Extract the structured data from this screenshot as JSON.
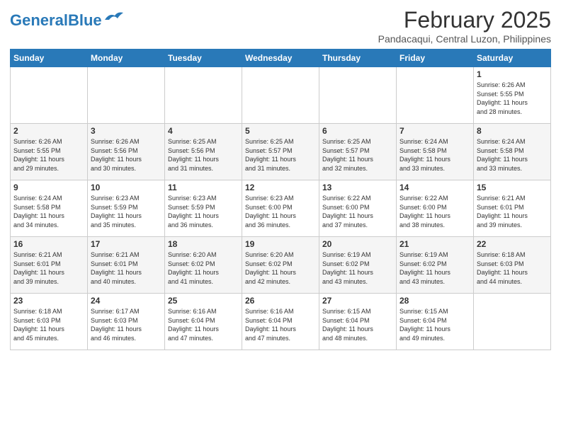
{
  "header": {
    "logo_general": "General",
    "logo_blue": "Blue",
    "month_title": "February 2025",
    "location": "Pandacaqui, Central Luzon, Philippines"
  },
  "weekdays": [
    "Sunday",
    "Monday",
    "Tuesday",
    "Wednesday",
    "Thursday",
    "Friday",
    "Saturday"
  ],
  "weeks": [
    [
      {
        "day": "",
        "info": ""
      },
      {
        "day": "",
        "info": ""
      },
      {
        "day": "",
        "info": ""
      },
      {
        "day": "",
        "info": ""
      },
      {
        "day": "",
        "info": ""
      },
      {
        "day": "",
        "info": ""
      },
      {
        "day": "1",
        "info": "Sunrise: 6:26 AM\nSunset: 5:55 PM\nDaylight: 11 hours\nand 28 minutes."
      }
    ],
    [
      {
        "day": "2",
        "info": "Sunrise: 6:26 AM\nSunset: 5:55 PM\nDaylight: 11 hours\nand 29 minutes."
      },
      {
        "day": "3",
        "info": "Sunrise: 6:26 AM\nSunset: 5:56 PM\nDaylight: 11 hours\nand 30 minutes."
      },
      {
        "day": "4",
        "info": "Sunrise: 6:25 AM\nSunset: 5:56 PM\nDaylight: 11 hours\nand 31 minutes."
      },
      {
        "day": "5",
        "info": "Sunrise: 6:25 AM\nSunset: 5:57 PM\nDaylight: 11 hours\nand 31 minutes."
      },
      {
        "day": "6",
        "info": "Sunrise: 6:25 AM\nSunset: 5:57 PM\nDaylight: 11 hours\nand 32 minutes."
      },
      {
        "day": "7",
        "info": "Sunrise: 6:24 AM\nSunset: 5:58 PM\nDaylight: 11 hours\nand 33 minutes."
      },
      {
        "day": "8",
        "info": "Sunrise: 6:24 AM\nSunset: 5:58 PM\nDaylight: 11 hours\nand 33 minutes."
      }
    ],
    [
      {
        "day": "9",
        "info": "Sunrise: 6:24 AM\nSunset: 5:58 PM\nDaylight: 11 hours\nand 34 minutes."
      },
      {
        "day": "10",
        "info": "Sunrise: 6:23 AM\nSunset: 5:59 PM\nDaylight: 11 hours\nand 35 minutes."
      },
      {
        "day": "11",
        "info": "Sunrise: 6:23 AM\nSunset: 5:59 PM\nDaylight: 11 hours\nand 36 minutes."
      },
      {
        "day": "12",
        "info": "Sunrise: 6:23 AM\nSunset: 6:00 PM\nDaylight: 11 hours\nand 36 minutes."
      },
      {
        "day": "13",
        "info": "Sunrise: 6:22 AM\nSunset: 6:00 PM\nDaylight: 11 hours\nand 37 minutes."
      },
      {
        "day": "14",
        "info": "Sunrise: 6:22 AM\nSunset: 6:00 PM\nDaylight: 11 hours\nand 38 minutes."
      },
      {
        "day": "15",
        "info": "Sunrise: 6:21 AM\nSunset: 6:01 PM\nDaylight: 11 hours\nand 39 minutes."
      }
    ],
    [
      {
        "day": "16",
        "info": "Sunrise: 6:21 AM\nSunset: 6:01 PM\nDaylight: 11 hours\nand 39 minutes."
      },
      {
        "day": "17",
        "info": "Sunrise: 6:21 AM\nSunset: 6:01 PM\nDaylight: 11 hours\nand 40 minutes."
      },
      {
        "day": "18",
        "info": "Sunrise: 6:20 AM\nSunset: 6:02 PM\nDaylight: 11 hours\nand 41 minutes."
      },
      {
        "day": "19",
        "info": "Sunrise: 6:20 AM\nSunset: 6:02 PM\nDaylight: 11 hours\nand 42 minutes."
      },
      {
        "day": "20",
        "info": "Sunrise: 6:19 AM\nSunset: 6:02 PM\nDaylight: 11 hours\nand 43 minutes."
      },
      {
        "day": "21",
        "info": "Sunrise: 6:19 AM\nSunset: 6:02 PM\nDaylight: 11 hours\nand 43 minutes."
      },
      {
        "day": "22",
        "info": "Sunrise: 6:18 AM\nSunset: 6:03 PM\nDaylight: 11 hours\nand 44 minutes."
      }
    ],
    [
      {
        "day": "23",
        "info": "Sunrise: 6:18 AM\nSunset: 6:03 PM\nDaylight: 11 hours\nand 45 minutes."
      },
      {
        "day": "24",
        "info": "Sunrise: 6:17 AM\nSunset: 6:03 PM\nDaylight: 11 hours\nand 46 minutes."
      },
      {
        "day": "25",
        "info": "Sunrise: 6:16 AM\nSunset: 6:04 PM\nDaylight: 11 hours\nand 47 minutes."
      },
      {
        "day": "26",
        "info": "Sunrise: 6:16 AM\nSunset: 6:04 PM\nDaylight: 11 hours\nand 47 minutes."
      },
      {
        "day": "27",
        "info": "Sunrise: 6:15 AM\nSunset: 6:04 PM\nDaylight: 11 hours\nand 48 minutes."
      },
      {
        "day": "28",
        "info": "Sunrise: 6:15 AM\nSunset: 6:04 PM\nDaylight: 11 hours\nand 49 minutes."
      },
      {
        "day": "",
        "info": ""
      }
    ]
  ]
}
